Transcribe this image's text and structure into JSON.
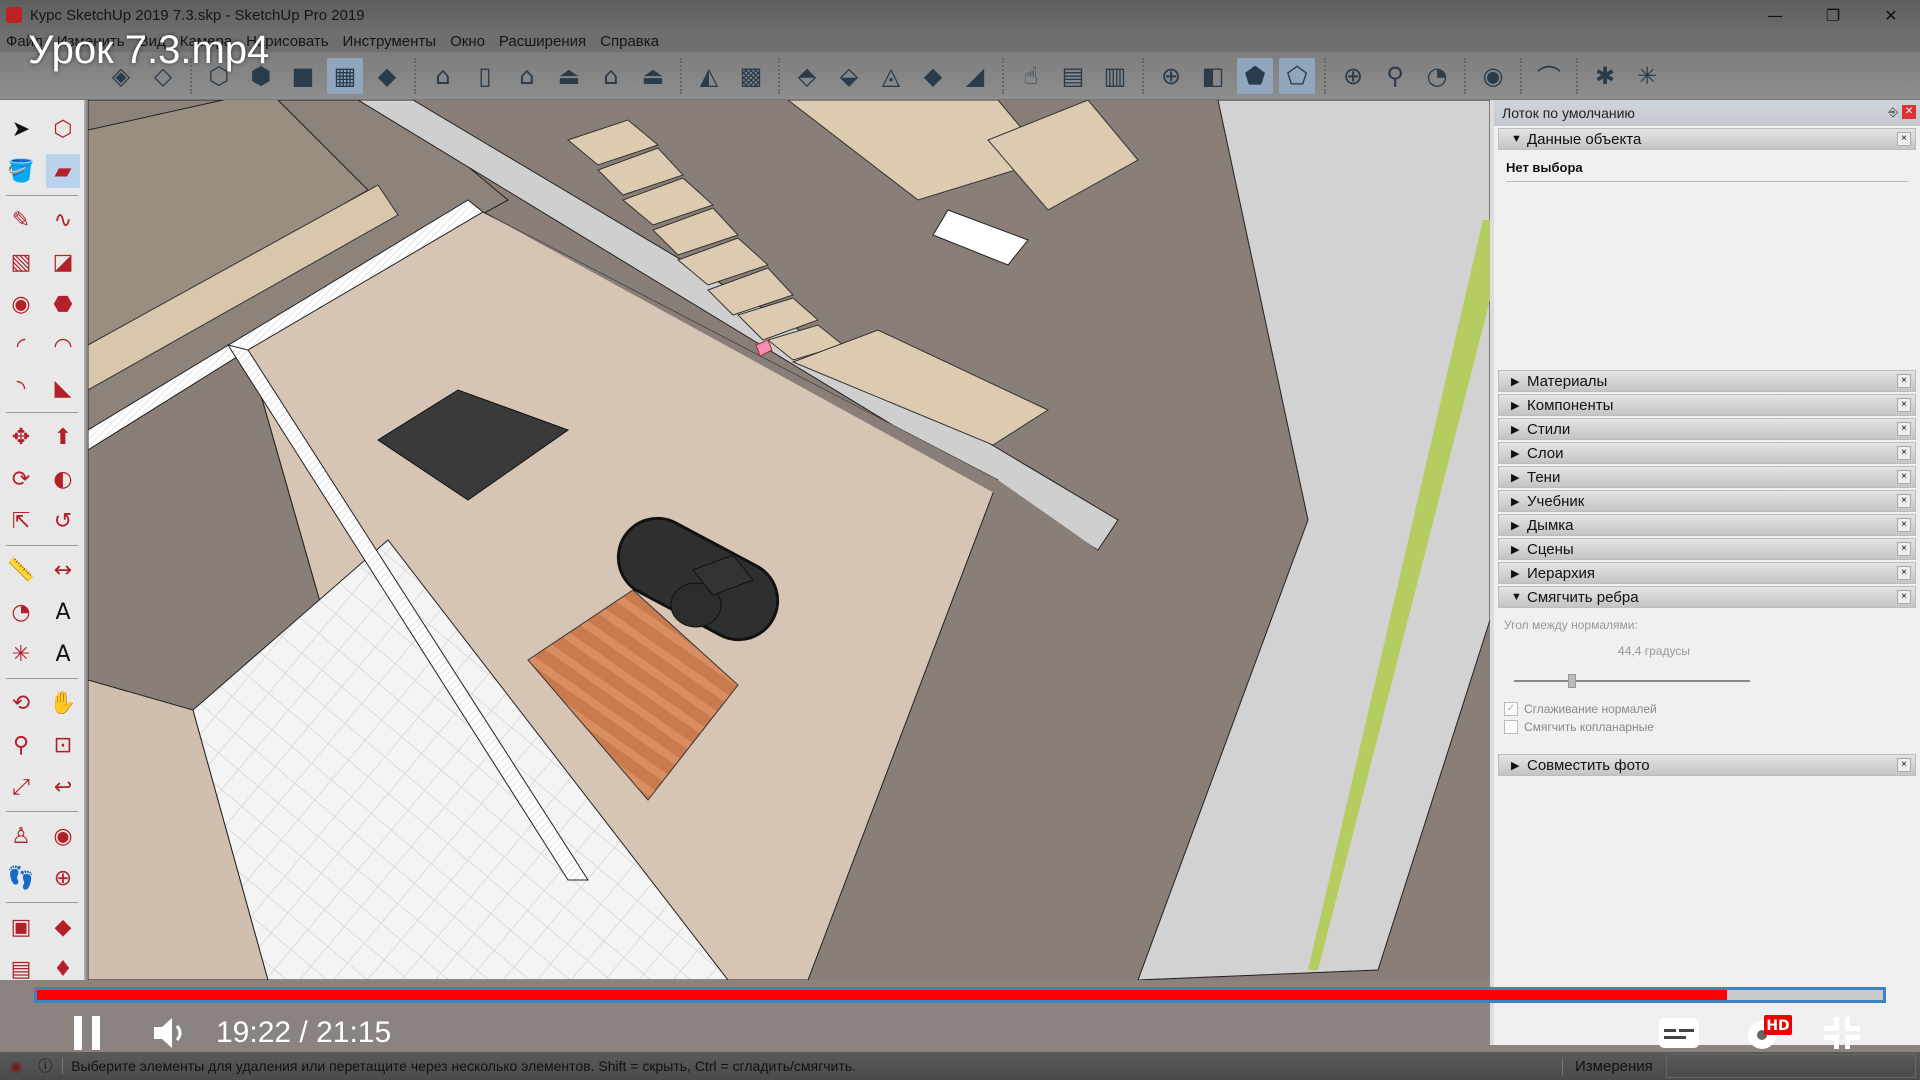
{
  "window": {
    "title": "Курс SketchUp 2019 7.3.skp - SketchUp Pro 2019",
    "minimize_icon": "minimize-icon",
    "restore_icon": "restore-icon",
    "close_icon": "close-icon"
  },
  "video_overlay": {
    "title": "Урок 7.3.mp4",
    "current_time": "19:22",
    "total_time": "21:15",
    "time_display": "19:22 / 21:15",
    "progress_fraction": 0.9157,
    "hd_badge": "HD",
    "accent_color": "#ff0000"
  },
  "menu": [
    "Файл",
    "Изменить",
    "Вид",
    "Камера",
    "Нарисовать",
    "Инструменты",
    "Окно",
    "Расширения",
    "Справка"
  ],
  "toolbar": {
    "groups": [
      [
        "xray-icon",
        "back-edges-icon"
      ],
      [
        "wireframe-icon",
        "hidden-line-icon",
        "shaded-icon",
        "shaded-textures-icon",
        "monochrome-icon"
      ],
      [
        "iso-view-icon",
        "top-view-icon",
        "front-view-icon",
        "right-view-icon",
        "back-view-icon",
        "left-view-icon"
      ],
      [
        "sandbox-from-contours-icon",
        "sandbox-from-scratch-icon"
      ],
      [
        "smoove-icon",
        "stamp-icon",
        "drape-icon",
        "add-detail-icon",
        "flip-edge-icon"
      ],
      [
        "interact-icon",
        "dynamic-components-options-icon",
        "dynamic-components-attributes-icon"
      ],
      [
        "position-camera-icon",
        "section-plane-icon",
        "section-display-icon",
        "section-cut-icon"
      ],
      [
        "north-arrow-icon",
        "set-north-icon",
        "location-icon"
      ],
      [
        "3d-warehouse-icon"
      ],
      [
        "follow-me-arc-icon"
      ],
      [
        "solar-north-icon",
        "solar-south-icon"
      ]
    ],
    "active": [
      "shaded-textures-icon",
      "section-display-icon",
      "section-cut-icon"
    ]
  },
  "left_tools": [
    [
      "select-icon",
      "make-component-icon"
    ],
    [
      "paint-bucket-icon",
      "eraser-icon"
    ],
    [
      "line-icon",
      "freehand-icon"
    ],
    [
      "rectangle-icon",
      "rotated-rectangle-icon"
    ],
    [
      "circle-icon",
      "polygon-icon"
    ],
    [
      "arc-icon",
      "2pt-arc-icon"
    ],
    [
      "3pt-arc-icon",
      "pie-icon"
    ],
    [
      "move-icon",
      "push-pull-icon"
    ],
    [
      "rotate-icon",
      "follow-me-icon"
    ],
    [
      "scale-icon",
      "offset-icon"
    ],
    [
      "tape-measure-icon",
      "dimension-icon"
    ],
    [
      "protractor-icon",
      "text-icon"
    ],
    [
      "axes-icon",
      "3d-text-icon"
    ],
    [
      "orbit-icon",
      "pan-icon"
    ],
    [
      "zoom-icon",
      "zoom-window-icon"
    ],
    [
      "zoom-extents-icon",
      "previous-view-icon"
    ],
    [
      "position-camera-icon",
      "look-around-icon"
    ],
    [
      "walk-icon",
      "section-plane-icon"
    ],
    [
      "extension-warehouse-icon",
      "ruby-console-icon"
    ],
    [
      "extension-manager-icon",
      "ruby-icon"
    ]
  ],
  "left_tools_active": "eraser-icon",
  "tray": {
    "title": "Лоток по умолчанию",
    "entity_info": {
      "label": "Данные объекта",
      "body": "Нет выбора"
    },
    "panels": [
      "Материалы",
      "Компоненты",
      "Стили",
      "Слои",
      "Тени",
      "Учебник",
      "Дымка",
      "Сцены",
      "Иерархия"
    ],
    "soften_edges": {
      "label": "Смягчить ребра",
      "angle_label": "Угол между нормалями:",
      "angle_value": "44,4 градусы",
      "angle_degrees": 44.4,
      "slider_fraction": 0.247,
      "smooth_normals_label": "Сглаживание нормалей",
      "smooth_normals_checked": true,
      "soften_coplanar_label": "Смягчить копланарные",
      "soften_coplanar_checked": false
    },
    "match_photo": "Совместить фото"
  },
  "status_bar": {
    "message": "Выберите элементы для удаления или перетащите через несколько элементов. Shift = скрыть, Ctrl = сгладить/смягчить.",
    "measurements_label": "Измерения",
    "measurements_value": ""
  }
}
